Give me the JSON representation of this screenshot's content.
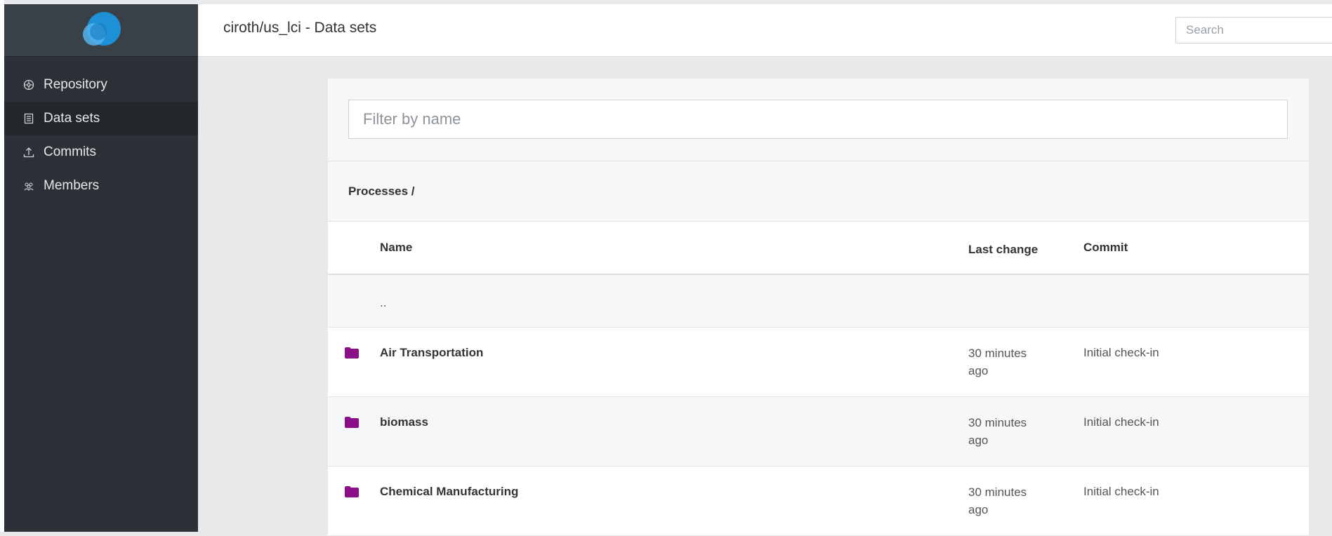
{
  "topbar": {
    "title": "ciroth/us_lci - Data sets",
    "search_placeholder": "Search"
  },
  "sidebar": {
    "items": [
      {
        "label": "Repository",
        "icon": "repository-icon"
      },
      {
        "label": "Data sets",
        "icon": "dataset-icon",
        "active": true
      },
      {
        "label": "Commits",
        "icon": "commit-icon"
      },
      {
        "label": "Members",
        "icon": "members-icon"
      }
    ]
  },
  "filter": {
    "placeholder": "Filter by name"
  },
  "breadcrumb": "Processes /",
  "table": {
    "columns": [
      "Name",
      "Last change",
      "Commit"
    ],
    "parent_label": "..",
    "rows": [
      {
        "name": "Air Transportation",
        "last_change": "30 minutes ago",
        "commit": "Initial check-in"
      },
      {
        "name": "biomass",
        "last_change": "30 minutes ago",
        "commit": "Initial check-in"
      },
      {
        "name": "Chemical Manufacturing",
        "last_change": "30 minutes ago",
        "commit": "Initial check-in"
      }
    ]
  },
  "colors": {
    "sidebar_bg": "#2c3138",
    "folder": "#8b0f86",
    "logo": "#1e90d6"
  }
}
